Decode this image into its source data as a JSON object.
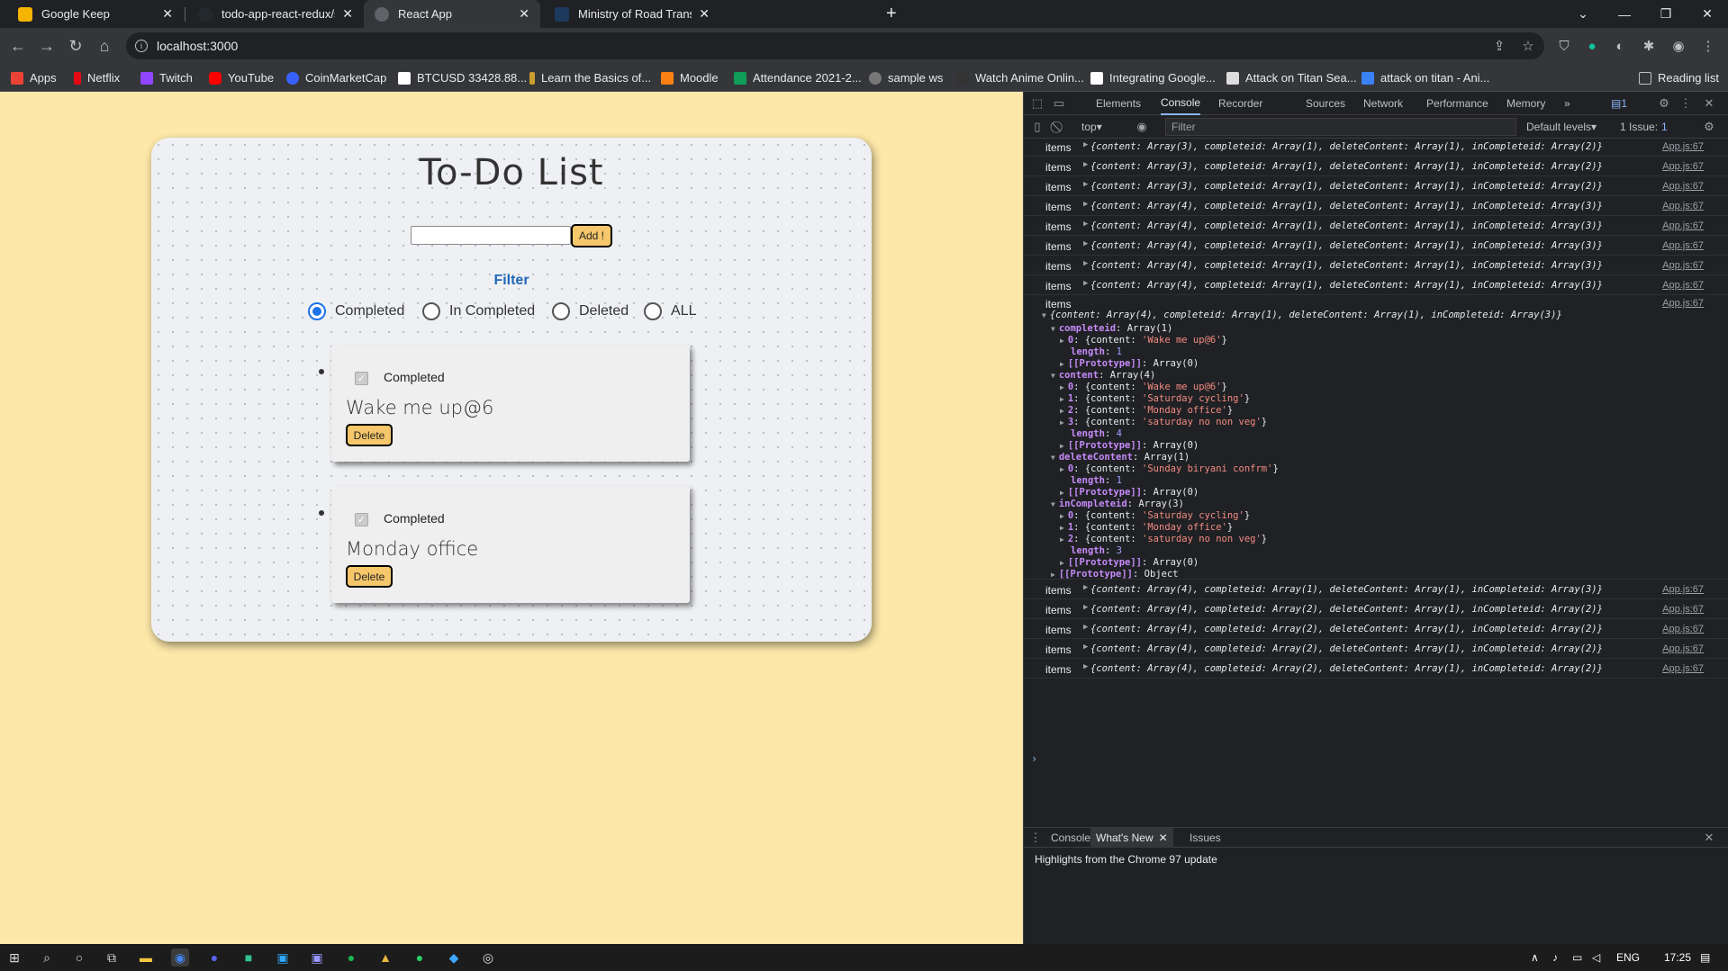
{
  "browser": {
    "tabs": [
      {
        "title": "Google Keep",
        "favicon_color": "#f4b400"
      },
      {
        "title": "todo-app-react-redux/src at mas",
        "favicon_color": "#24292e"
      },
      {
        "title": "React App",
        "favicon_color": "#5f6368"
      },
      {
        "title": "Ministry of Road Transport and H",
        "favicon_color": "#1e3a5f"
      }
    ],
    "new_tab_label": "+",
    "url": "localhost:3000",
    "bookmarks": [
      {
        "label": "Apps",
        "color": "#ea4335"
      },
      {
        "label": "Netflix",
        "color": "#e50914"
      },
      {
        "label": "Twitch",
        "color": "#9146ff"
      },
      {
        "label": "YouTube",
        "color": "#ff0000"
      },
      {
        "label": "CoinMarketCap",
        "color": "#3861fb"
      },
      {
        "label": "BTCUSD 33428.88...",
        "color": "#ffffff"
      },
      {
        "label": "Learn the Basics of...",
        "color": "#c99d2e"
      },
      {
        "label": "Moodle",
        "color": "#f98012"
      },
      {
        "label": "Attendance 2021-2...",
        "color": "#0f9d58"
      },
      {
        "label": "sample ws",
        "color": "#777777"
      },
      {
        "label": "Watch Anime Onlin...",
        "color": "#333333"
      },
      {
        "label": "Integrating Google...",
        "color": "#ffffff"
      },
      {
        "label": "Attack on Titan Sea...",
        "color": "#dddddd"
      },
      {
        "label": "attack on titan - Ani...",
        "color": "#3b82f6"
      }
    ],
    "reading_list": "Reading list"
  },
  "app": {
    "title": "To-Do List",
    "add_label": "Add !",
    "input_value": "",
    "filter_label": "Filter",
    "filters": [
      "Completed",
      "In Completed",
      "Deleted",
      "ALL"
    ],
    "selected_filter": "Completed",
    "items": [
      {
        "status": "Completed",
        "text": "Wake me up@6",
        "delete_label": "Delete"
      },
      {
        "status": "Completed",
        "text": "Monday office",
        "delete_label": "Delete"
      }
    ]
  },
  "devtools": {
    "tabs": [
      "Elements",
      "Console",
      "Recorder",
      "Sources",
      "Network",
      "Performance",
      "Memory"
    ],
    "more": "»",
    "badge": "1",
    "context": "top",
    "filter_placeholder": "Filter",
    "levels": "Default levels",
    "issues": "1 Issue:",
    "issues_count": "1",
    "logs_before": [
      {
        "label": "items",
        "value": "{content: Array(3), completeid: Array(1), deleteContent: Array(1), inCompleteid: Array(2)}",
        "src": "App.js:67"
      },
      {
        "label": "items",
        "value": "{content: Array(3), completeid: Array(1), deleteContent: Array(1), inCompleteid: Array(2)}",
        "src": "App.js:67"
      },
      {
        "label": "items",
        "value": "{content: Array(3), completeid: Array(1), deleteContent: Array(1), inCompleteid: Array(2)}",
        "src": "App.js:67"
      },
      {
        "label": "items",
        "value": "{content: Array(4), completeid: Array(1), deleteContent: Array(1), inCompleteid: Array(3)}",
        "src": "App.js:67"
      },
      {
        "label": "items",
        "value": "{content: Array(4), completeid: Array(1), deleteContent: Array(1), inCompleteid: Array(3)}",
        "src": "App.js:67"
      },
      {
        "label": "items",
        "value": "{content: Array(4), completeid: Array(1), deleteContent: Array(1), inCompleteid: Array(3)}",
        "src": "App.js:67"
      },
      {
        "label": "items",
        "value": "{content: Array(4), completeid: Array(1), deleteContent: Array(1), inCompleteid: Array(3)}",
        "src": "App.js:67"
      },
      {
        "label": "items",
        "value": "{content: Array(4), completeid: Array(1), deleteContent: Array(1), inCompleteid: Array(3)}",
        "src": "App.js:67"
      }
    ],
    "expanded": {
      "label": "items",
      "src": "App.js:67",
      "summary": "{content: Array(4), completeid: Array(1), deleteContent: Array(1), inCompleteid: Array(3)}",
      "lines": [
        {
          "depth": 1,
          "key": "completeid",
          "val": "Array(1)",
          "open": true
        },
        {
          "depth": 2,
          "key": "0",
          "val": "{content: 'Wake me up@6'}",
          "tri": true
        },
        {
          "depth": 2,
          "key": "length",
          "val": "1"
        },
        {
          "depth": 2,
          "key": "[[Prototype]]",
          "val": "Array(0)",
          "tri": true
        },
        {
          "depth": 1,
          "key": "content",
          "val": "Array(4)",
          "open": true
        },
        {
          "depth": 2,
          "key": "0",
          "val": "{content: 'Wake me up@6'}",
          "tri": true
        },
        {
          "depth": 2,
          "key": "1",
          "val": "{content: 'Saturday cycling'}",
          "tri": true
        },
        {
          "depth": 2,
          "key": "2",
          "val": "{content: 'Monday office'}",
          "tri": true
        },
        {
          "depth": 2,
          "key": "3",
          "val": "{content: 'saturday no non veg'}",
          "tri": true
        },
        {
          "depth": 2,
          "key": "length",
          "val": "4"
        },
        {
          "depth": 2,
          "key": "[[Prototype]]",
          "val": "Array(0)",
          "tri": true
        },
        {
          "depth": 1,
          "key": "deleteContent",
          "val": "Array(1)",
          "open": true
        },
        {
          "depth": 2,
          "key": "0",
          "val": "{content: 'Sunday biryani confrm'}",
          "tri": true
        },
        {
          "depth": 2,
          "key": "length",
          "val": "1"
        },
        {
          "depth": 2,
          "key": "[[Prototype]]",
          "val": "Array(0)",
          "tri": true
        },
        {
          "depth": 1,
          "key": "inCompleteid",
          "val": "Array(3)",
          "open": true
        },
        {
          "depth": 2,
          "key": "0",
          "val": "{content: 'Saturday cycling'}",
          "tri": true
        },
        {
          "depth": 2,
          "key": "1",
          "val": "{content: 'Monday office'}",
          "tri": true
        },
        {
          "depth": 2,
          "key": "2",
          "val": "{content: 'saturday no non veg'}",
          "tri": true
        },
        {
          "depth": 2,
          "key": "length",
          "val": "3"
        },
        {
          "depth": 2,
          "key": "[[Prototype]]",
          "val": "Array(0)",
          "tri": true
        },
        {
          "depth": 1,
          "key": "[[Prototype]]",
          "val": "Object",
          "tri": true
        }
      ]
    },
    "logs_after": [
      {
        "label": "items",
        "value": "{content: Array(4), completeid: Array(1), deleteContent: Array(1), inCompleteid: Array(3)}",
        "src": "App.js:67"
      },
      {
        "label": "items",
        "value": "{content: Array(4), completeid: Array(2), deleteContent: Array(1), inCompleteid: Array(2)}",
        "src": "App.js:67"
      },
      {
        "label": "items",
        "value": "{content: Array(4), completeid: Array(2), deleteContent: Array(1), inCompleteid: Array(2)}",
        "src": "App.js:67"
      },
      {
        "label": "items",
        "value": "{content: Array(4), completeid: Array(2), deleteContent: Array(1), inCompleteid: Array(2)}",
        "src": "App.js:67"
      },
      {
        "label": "items",
        "value": "{content: Array(4), completeid: Array(2), deleteContent: Array(1), inCompleteid: Array(2)}",
        "src": "App.js:67"
      }
    ],
    "prompt": "›",
    "drawer_tabs": [
      "Console",
      "What's New",
      "Issues"
    ],
    "whats_new": "Highlights from the Chrome 97 update"
  },
  "taskbar": {
    "language": "ENG",
    "time": "17:25"
  }
}
